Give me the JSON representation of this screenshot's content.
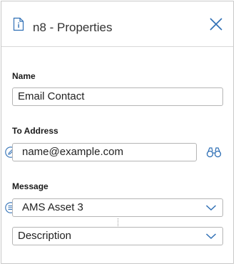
{
  "header": {
    "title": "n8 - Properties"
  },
  "icons": {
    "document": "document-info-icon",
    "close": "close-icon",
    "edit": "pencil-icon",
    "find": "binoculars-icon",
    "list": "list-icon",
    "chevron": "chevron-down-icon"
  },
  "colors": {
    "accent": "#2f6fb5",
    "border": "#b5b5b5",
    "text": "#222222"
  },
  "fields": {
    "name": {
      "label": "Name",
      "value": "Email Contact"
    },
    "to_address": {
      "label": "To Address",
      "value": "name@example.com"
    },
    "message": {
      "label": "Message",
      "selected_source": "AMS Asset 3",
      "selected_field": "Description"
    }
  }
}
